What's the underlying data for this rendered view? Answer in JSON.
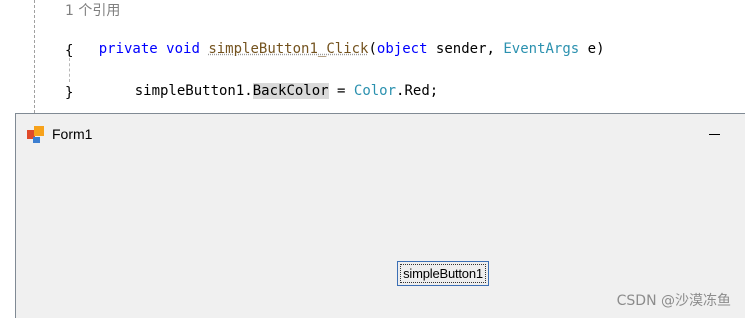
{
  "code": {
    "reference_count": "1 个引用",
    "line_signature": {
      "access": "private",
      "return_type": "void",
      "method": "simpleButton1_Click",
      "open_paren": "(",
      "param1_type": "object",
      "param1_name": " sender, ",
      "param2_type": "EventArgs",
      "param2_name": " e)"
    },
    "open_brace": "{",
    "statement": {
      "target": "simpleButton1.",
      "property": "BackColor",
      "assign": " = ",
      "type": "Color",
      "value": ".Red;"
    },
    "close_brace": "}"
  },
  "form": {
    "title": "Form1",
    "minimize_glyph": "",
    "button_label": "simpleButton1"
  },
  "watermark": "CSDN @沙漠冻鱼"
}
